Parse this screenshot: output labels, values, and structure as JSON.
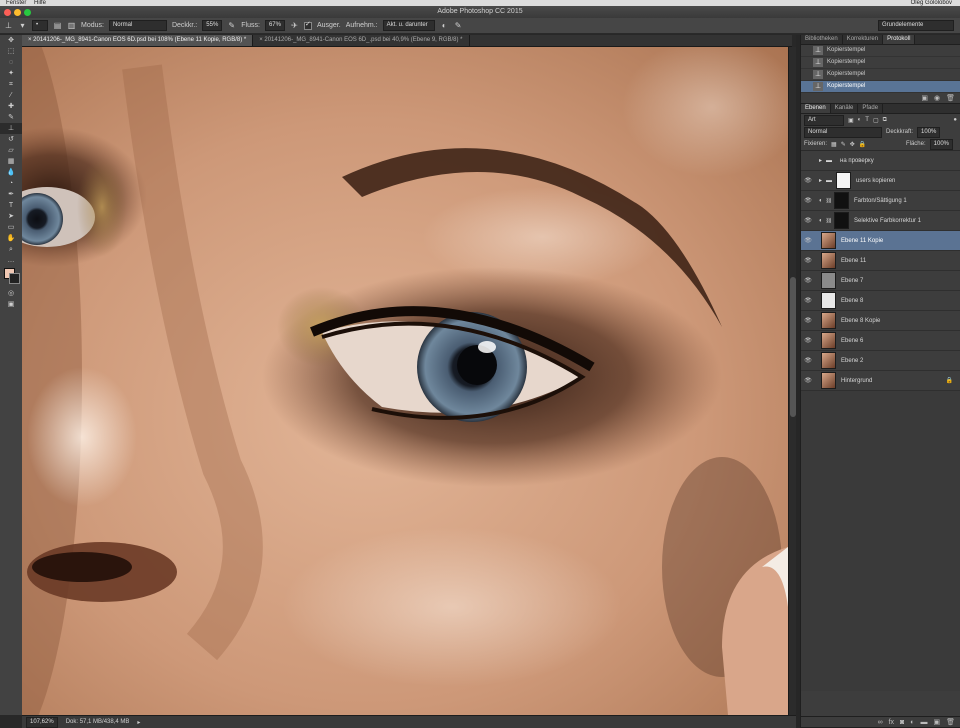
{
  "menubar": {
    "left": [
      "Fenster",
      "Hilfe"
    ],
    "right": "Oleg Gololobov"
  },
  "window": {
    "title": "Adobe Photoshop CC 2015",
    "workspace": "Grundelemente"
  },
  "options": {
    "modus_label": "Modus:",
    "modus_value": "Normal",
    "deckkraft_label": "Deckkr.:",
    "deckkraft_value": "55%",
    "fluss_label": "Fluss:",
    "fluss_value": "67%",
    "ausger_label": "Ausger.",
    "aufnehm_label": "Aufnehm.:",
    "aufnehm_value": "Akt. u. darunter"
  },
  "tabs": [
    {
      "label": "20141206-_MG_8941-Canon EOS 6D.psd bei 108% (Ebene 11 Kopie, RGB/8) *",
      "active": true
    },
    {
      "label": "20141206-_MG_8941-Canon EOS 6D_.psd bei 40,9% (Ebene 9, RGB/8) *",
      "active": false
    }
  ],
  "status": {
    "zoom": "107,62%",
    "doc": "Dok: 57,1 MB/438,4 MB"
  },
  "history_panel": {
    "tabs": [
      "Bibliotheken",
      "Korrekturen",
      "Protokoll"
    ],
    "active_tab": "Protokoll",
    "items": [
      "Kopierstempel",
      "Kopierstempel",
      "Kopierstempel",
      "Kopierstempel"
    ],
    "selected": 3
  },
  "layers_panel": {
    "tabs": [
      "Ebenen",
      "Kanäle",
      "Pfade"
    ],
    "active_tab": "Ebenen",
    "filter_label": "Art",
    "blend_mode": "Normal",
    "opacity_label": "Deckkraft:",
    "opacity_value": "100%",
    "lock_label": "Fixieren:",
    "fill_label": "Fläche:",
    "fill_value": "100%",
    "layers": [
      {
        "name": "на проверку",
        "kind": "group",
        "visible": false
      },
      {
        "name": "users kopieren",
        "kind": "group",
        "visible": true
      },
      {
        "name": "Farbton/Sättigung 1",
        "kind": "adjust",
        "visible": true
      },
      {
        "name": "Selektive Farbkorrektur 1",
        "kind": "adjust",
        "visible": true
      },
      {
        "name": "Ebene 11 Kopie",
        "kind": "photo",
        "visible": true,
        "selected": true
      },
      {
        "name": "Ebene 11",
        "kind": "photo",
        "visible": true
      },
      {
        "name": "Ebene 7",
        "kind": "gray",
        "visible": true
      },
      {
        "name": "Ebene 8",
        "kind": "light",
        "visible": true
      },
      {
        "name": "Ebene 8 Kopie",
        "kind": "photo",
        "visible": true
      },
      {
        "name": "Ebene 6",
        "kind": "photo",
        "visible": true
      },
      {
        "name": "Ebene 2",
        "kind": "photo",
        "visible": true
      },
      {
        "name": "Hintergrund",
        "kind": "photo",
        "visible": true,
        "locked": true
      }
    ]
  },
  "colors": {
    "accent_selected": "#5b7393",
    "panel_bg": "#3d3d3d",
    "foreground_swatch": "#f0c8b4",
    "background_swatch": "#222222"
  }
}
